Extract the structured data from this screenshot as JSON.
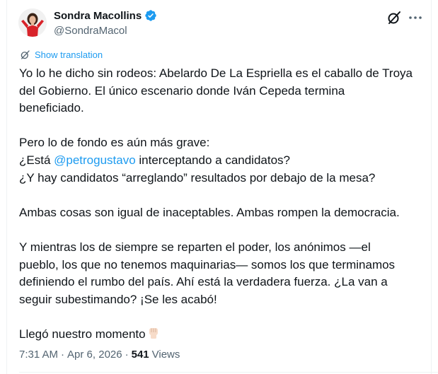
{
  "author": {
    "name": "Sondra Macollins",
    "handle": "@SondraMacol",
    "verified_color": "#1d9bf0"
  },
  "actions": {
    "grok_icon": "grok-slash-circle-icon",
    "more_icon": "more-horizontal-icon"
  },
  "translation": {
    "label": "Show translation"
  },
  "post": {
    "p1": {
      "l1": "Yo lo he dicho sin rodeos: Abelardo De La Espriella es el caballo de Troya",
      "l2": "del Gobierno. El único escenario donde Iván Cepeda termina",
      "l3": "beneficiado."
    },
    "p2": {
      "l1": "Pero lo de fondo es aún más grave:",
      "l2_pre": "¿Está ",
      "mention": "@petrogustavo",
      "l2_post": " interceptando a candidatos?",
      "l3": "¿Y hay candidatos “arreglando” resultados por debajo de la mesa?"
    },
    "p3": {
      "l1": "Ambas cosas son igual de inaceptables. Ambas rompen la democracia."
    },
    "p4": {
      "l1": "Y mientras los de siempre se reparten el poder, los anónimos —el",
      "l2": "pueblo, los que no tenemos maquinarias— somos los que terminamos",
      "l3": "definiendo el rumbo del país. Ahí está la verdadera fuerza. ¿La van a",
      "l4": "seguir subestimando? ¡Se les acabó!"
    },
    "p5": {
      "l1": "Llegó nuestro momento",
      "emoji": "raised-fist-emoji"
    }
  },
  "meta": {
    "time": "7:31 AM",
    "dot1": "·",
    "date": "Apr 6, 2026",
    "dot2": "·",
    "views_count": "541",
    "views_label": "Views"
  }
}
